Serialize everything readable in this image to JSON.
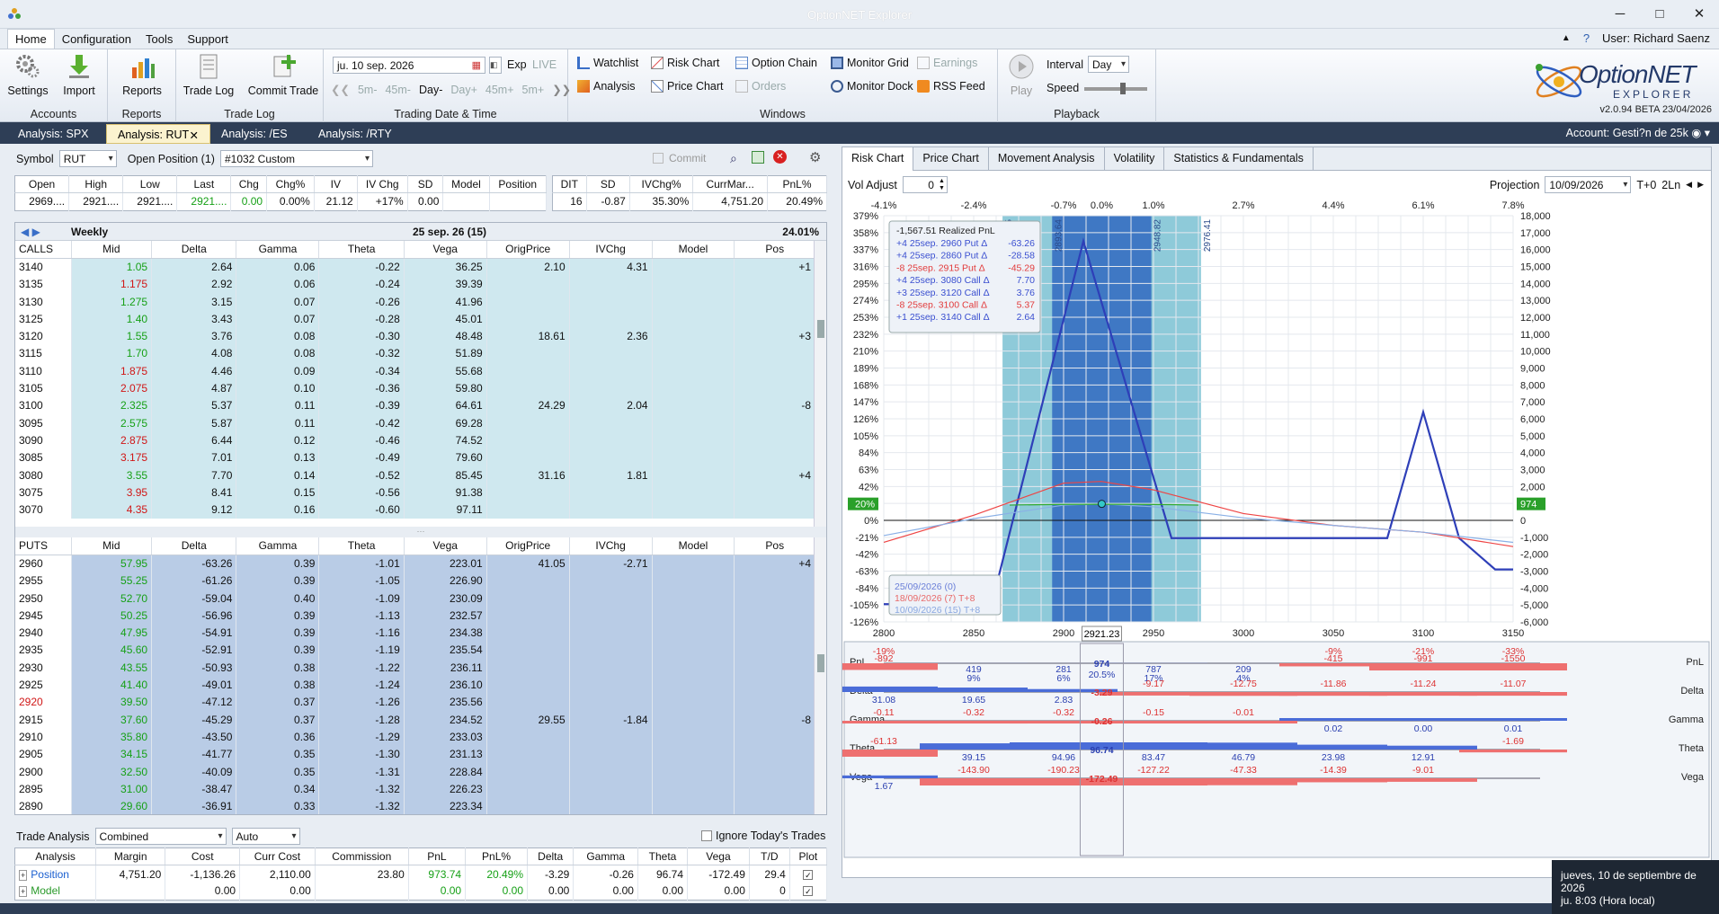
{
  "window": {
    "title": "OptionNET Explorer"
  },
  "menu": {
    "items": [
      "Home",
      "Configuration",
      "Tools",
      "Support"
    ],
    "user": "User: Richard Saenz"
  },
  "ribbon": {
    "settings": "Settings",
    "import": "Import",
    "accounts": "Accounts",
    "reports": "Reports",
    "reports_group": "Reports",
    "trade_log": "Trade Log",
    "commit_trade": "Commit Trade",
    "trade_log_group": "Trade Log",
    "date": "ju. 10 sep. 2026",
    "exp": "Exp",
    "live": "LIVE",
    "steps": [
      "5m-",
      "45m-",
      "Day-",
      "Day+",
      "45m+",
      "5m+"
    ],
    "trading_group": "Trading Date & Time",
    "watchlist": "Watchlist",
    "risk_chart": "Risk Chart",
    "option_chain": "Option Chain",
    "monitor_grid": "Monitor Grid",
    "earnings": "Earnings",
    "analysis": "Analysis",
    "price_chart": "Price Chart",
    "orders": "Orders",
    "monitor_dock": "Monitor Dock",
    "rss_feed": "RSS Feed",
    "windows_group": "Windows",
    "play": "Play",
    "interval_label": "Interval",
    "interval_value": "Day",
    "speed_label": "Speed",
    "playback_group": "Playback",
    "logo_main": "OptionNET",
    "logo_sub": "EXPLORER",
    "version": "v2.0.94 BETA 23/04/2026"
  },
  "tabs": [
    {
      "label": "Analysis: SPX"
    },
    {
      "label": "Analysis: RUT",
      "active": true
    },
    {
      "label": "Analysis: /ES"
    },
    {
      "label": "Analysis: /RTY"
    }
  ],
  "account": "Account: Gesti?n de 25k",
  "left": {
    "symbol_label": "Symbol",
    "symbol": "RUT",
    "open_position_label": "Open Position (1)",
    "position": "#1032 Custom",
    "commit": "Commit",
    "quote_headers": [
      "Open",
      "High",
      "Low",
      "Last",
      "Chg",
      "Chg%",
      "IV",
      "IV Chg",
      "SD",
      "Model",
      "Position"
    ],
    "quote_values": [
      "2969....",
      "2921....",
      "2921....",
      "2921....",
      "0.00",
      "0.00%",
      "21.12",
      "+17%",
      "0.00",
      "",
      ""
    ],
    "pos_headers": [
      "DIT",
      "SD",
      "IVChg%",
      "CurrMar...",
      "PnL%"
    ],
    "pos_values": [
      "16",
      "-0.87",
      "35.30%",
      "4,751.20",
      "20.49%"
    ],
    "weekly": "Weekly",
    "expiry": "25 sep. 26 (15)",
    "expiry_pct": "24.01%",
    "chain_headers": [
      "Mid",
      "Delta",
      "Gamma",
      "Theta",
      "Vega",
      "OrigPrice",
      "IVChg",
      "Model",
      "Pos"
    ],
    "calls_label": "CALLS",
    "puts_label": "PUTS",
    "calls": [
      [
        "3140",
        "1.05",
        "g",
        "2.64",
        "0.06",
        "-0.22",
        "36.25",
        "2.10",
        "4.31",
        "",
        "+1"
      ],
      [
        "3135",
        "1.175",
        "r",
        "2.92",
        "0.06",
        "-0.24",
        "39.39",
        "",
        "",
        "",
        ""
      ],
      [
        "3130",
        "1.275",
        "g",
        "3.15",
        "0.07",
        "-0.26",
        "41.96",
        "",
        "",
        "",
        ""
      ],
      [
        "3125",
        "1.40",
        "g",
        "3.43",
        "0.07",
        "-0.28",
        "45.01",
        "",
        "",
        "",
        ""
      ],
      [
        "3120",
        "1.55",
        "g",
        "3.76",
        "0.08",
        "-0.30",
        "48.48",
        "18.61",
        "2.36",
        "",
        "+3"
      ],
      [
        "3115",
        "1.70",
        "g",
        "4.08",
        "0.08",
        "-0.32",
        "51.89",
        "",
        "",
        "",
        ""
      ],
      [
        "3110",
        "1.875",
        "r",
        "4.46",
        "0.09",
        "-0.34",
        "55.68",
        "",
        "",
        "",
        ""
      ],
      [
        "3105",
        "2.075",
        "r",
        "4.87",
        "0.10",
        "-0.36",
        "59.80",
        "",
        "",
        "",
        ""
      ],
      [
        "3100",
        "2.325",
        "g",
        "5.37",
        "0.11",
        "-0.39",
        "64.61",
        "24.29",
        "2.04",
        "",
        "-8"
      ],
      [
        "3095",
        "2.575",
        "g",
        "5.87",
        "0.11",
        "-0.42",
        "69.28",
        "",
        "",
        "",
        ""
      ],
      [
        "3090",
        "2.875",
        "r",
        "6.44",
        "0.12",
        "-0.46",
        "74.52",
        "",
        "",
        "",
        ""
      ],
      [
        "3085",
        "3.175",
        "r",
        "7.01",
        "0.13",
        "-0.49",
        "79.60",
        "",
        "",
        "",
        ""
      ],
      [
        "3080",
        "3.55",
        "g",
        "7.70",
        "0.14",
        "-0.52",
        "85.45",
        "31.16",
        "1.81",
        "",
        "+4"
      ],
      [
        "3075",
        "3.95",
        "r",
        "8.41",
        "0.15",
        "-0.56",
        "91.38",
        "",
        "",
        "",
        ""
      ],
      [
        "3070",
        "4.35",
        "r",
        "9.12",
        "0.16",
        "-0.60",
        "97.11",
        "",
        "",
        "",
        ""
      ]
    ],
    "puts": [
      [
        "2960",
        "57.95",
        "g",
        "-63.26",
        "0.39",
        "-1.01",
        "223.01",
        "41.05",
        "-2.71",
        "",
        "+4"
      ],
      [
        "2955",
        "55.25",
        "g",
        "-61.26",
        "0.39",
        "-1.05",
        "226.90",
        "",
        "",
        "",
        ""
      ],
      [
        "2950",
        "52.70",
        "g",
        "-59.04",
        "0.40",
        "-1.09",
        "230.09",
        "",
        "",
        "",
        ""
      ],
      [
        "2945",
        "50.25",
        "g",
        "-56.96",
        "0.39",
        "-1.13",
        "232.57",
        "",
        "",
        "",
        ""
      ],
      [
        "2940",
        "47.95",
        "g",
        "-54.91",
        "0.39",
        "-1.16",
        "234.38",
        "",
        "",
        "",
        ""
      ],
      [
        "2935",
        "45.60",
        "g",
        "-52.91",
        "0.39",
        "-1.19",
        "235.54",
        "",
        "",
        "",
        ""
      ],
      [
        "2930",
        "43.55",
        "g",
        "-50.93",
        "0.38",
        "-1.22",
        "236.11",
        "",
        "",
        "",
        ""
      ],
      [
        "2925",
        "41.40",
        "g",
        "-49.01",
        "0.38",
        "-1.24",
        "236.10",
        "",
        "",
        "",
        ""
      ],
      [
        "2920",
        "39.50",
        "g",
        "-47.12",
        "0.37",
        "-1.26",
        "235.56",
        "",
        "",
        "",
        ""
      ],
      [
        "2915",
        "37.60",
        "g",
        "-45.29",
        "0.37",
        "-1.28",
        "234.52",
        "29.55",
        "-1.84",
        "",
        "-8"
      ],
      [
        "2910",
        "35.80",
        "g",
        "-43.50",
        "0.36",
        "-1.29",
        "233.03",
        "",
        "",
        "",
        ""
      ],
      [
        "2905",
        "34.15",
        "g",
        "-41.77",
        "0.35",
        "-1.30",
        "231.13",
        "",
        "",
        "",
        ""
      ],
      [
        "2900",
        "32.50",
        "g",
        "-40.09",
        "0.35",
        "-1.31",
        "228.84",
        "",
        "",
        "",
        ""
      ],
      [
        "2895",
        "31.00",
        "g",
        "-38.47",
        "0.34",
        "-1.32",
        "226.23",
        "",
        "",
        "",
        ""
      ],
      [
        "2890",
        "29.60",
        "g",
        "-36.91",
        "0.33",
        "-1.32",
        "223.34",
        "",
        "",
        "",
        ""
      ]
    ],
    "trade_analysis_label": "Trade Analysis",
    "combined": "Combined",
    "auto": "Auto",
    "ignore_today": "Ignore Today's Trades",
    "ta_headers": [
      "Analysis",
      "Margin",
      "Cost",
      "Curr Cost",
      "Commission",
      "PnL",
      "PnL%",
      "Delta",
      "Gamma",
      "Theta",
      "Vega",
      "T/D",
      "Plot"
    ],
    "ta_position": [
      "Position",
      "4,751.20",
      "-1,136.26",
      "2,110.00",
      "23.80",
      "973.74",
      "20.49%",
      "-3.29",
      "-0.26",
      "96.74",
      "-172.49",
      "29.4",
      ""
    ],
    "ta_model": [
      "Model",
      "",
      "0.00",
      "0.00",
      "",
      "0.00",
      "0.00",
      "0.00",
      "0.00",
      "0.00",
      "0.00",
      "0",
      ""
    ]
  },
  "right": {
    "tabs": [
      "Risk Chart",
      "Price Chart",
      "Movement Analysis",
      "Volatility",
      "Statistics & Fundamentals"
    ],
    "vol_adjust_label": "Vol Adjust",
    "vol_adjust": "0",
    "projection_label": "Projection",
    "projection_date": "10/09/2026",
    "tplus": "T+0",
    "lines": "2Ln",
    "legend_title": "-1,567.51 Realized PnL",
    "legend": [
      {
        "text": "+4 25sep. 2960 Put Δ",
        "val": "-63.26",
        "color": "#3a4fd0"
      },
      {
        "text": "+4 25sep. 2860 Put Δ",
        "val": "-28.58",
        "color": "#3a4fd0"
      },
      {
        "text": "-8 25sep. 2915 Put Δ",
        "val": "-45.29",
        "color": "#e23b3b"
      },
      {
        "text": "+4 25sep. 3080 Call Δ",
        "val": "7.70",
        "color": "#3a4fd0"
      },
      {
        "text": "+3 25sep. 3120 Call Δ",
        "val": "3.76",
        "color": "#3a4fd0"
      },
      {
        "text": "-8 25sep. 3100 Call Δ",
        "val": "5.37",
        "color": "#e23b3b"
      },
      {
        "text": "+1 25sep. 3140 Call Δ",
        "val": "2.64",
        "color": "#3a4fd0"
      }
    ],
    "date_legend": [
      {
        "text": "25/09/2026 (0)",
        "color": "#6a7fd8"
      },
      {
        "text": "18/09/2026 (7) T+8",
        "color": "#e86a6a"
      },
      {
        "text": "10/09/2026 (15) T+8",
        "color": "#8aa8e0"
      }
    ],
    "pct_labels": [
      "-4.1%",
      "-2.4%",
      "-0.7%",
      "0.0%",
      "1.0%",
      "2.7%",
      "4.4%",
      "6.1%",
      "7.8%"
    ],
    "left_axis": [
      "379%",
      "358%",
      "337%",
      "316%",
      "295%",
      "274%",
      "253%",
      "232%",
      "210%",
      "189%",
      "168%",
      "147%",
      "126%",
      "105%",
      "84%",
      "63%",
      "42%",
      "20%",
      "0%",
      "-21%",
      "-42%",
      "-63%",
      "-84%",
      "-105%",
      "-126%"
    ],
    "right_axis": [
      "18,000",
      "17,000",
      "16,000",
      "15,000",
      "14,000",
      "13,000",
      "12,000",
      "11,000",
      "10,000",
      "9,000",
      "8,000",
      "7,000",
      "6,000",
      "5,000",
      "4,000",
      "3,000",
      "2,000",
      "1,000",
      "0",
      "-1,000",
      "-2,000",
      "-3,000",
      "-4,000",
      "-5,000",
      "-6,000"
    ],
    "x_labels": [
      "2800",
      "2850",
      "2900",
      "2950",
      "3000",
      "3050",
      "3100",
      "3150"
    ],
    "spot_label": "2921.23",
    "band_labels": [
      "2866.05",
      "2893.64",
      "2948.82",
      "2976.41"
    ],
    "current_left": "20%",
    "current_right": "974",
    "greek_rows": [
      {
        "name": "PnL",
        "cur": "974",
        "cur2": "20.5%",
        "vals": [
          "-19%",
          "-892",
          "419",
          "9%",
          "281",
          "6%",
          "787",
          "17%",
          "209",
          "4%",
          "-9%",
          "-415",
          "-21%",
          "-991",
          "-33%",
          "-1550"
        ]
      },
      {
        "name": "Delta",
        "cur": "-3.29",
        "vals": [
          "31.08",
          "19.65",
          "2.83",
          "-9.17",
          "-12.75",
          "-11.86",
          "-11.24",
          "-11.07"
        ]
      },
      {
        "name": "Gamma",
        "cur": "-0.26",
        "vals": [
          "-0.11",
          "-0.32",
          "-0.32",
          "-0.15",
          "-0.01",
          "0.02",
          "0.00",
          "0.01"
        ]
      },
      {
        "name": "Theta",
        "cur": "96.74",
        "vals": [
          "-61.13",
          "39.15",
          "94.96",
          "83.47",
          "46.79",
          "23.98",
          "12.91",
          "-1.69"
        ]
      },
      {
        "name": "Vega",
        "cur": "-172.49",
        "vals": [
          "1.67",
          "-143.90",
          "-190.23",
          "-127.22",
          "-47.33",
          "-14.39",
          "-9.01",
          ""
        ]
      }
    ]
  },
  "chart_data": {
    "type": "line",
    "x_range": [
      2800,
      3150
    ],
    "pnl_range": [
      -6000,
      18000
    ],
    "series": [
      {
        "name": "25/09/2026 (0)",
        "x": [
          2800,
          2860,
          2911,
          2960,
          2980,
          3080,
          3100,
          3120,
          3140,
          3150
        ],
        "y": [
          -4950,
          -4950,
          16500,
          -1050,
          -1050,
          -1050,
          6400,
          -1050,
          -2900,
          -2900
        ]
      },
      {
        "name": "18/09/2026 (7) T+8",
        "x": [
          2800,
          2850,
          2900,
          2921,
          2950,
          3000,
          3050,
          3100,
          3150
        ],
        "y": [
          -1300,
          300,
          2200,
          2300,
          1800,
          400,
          -300,
          -700,
          -1550
        ]
      },
      {
        "name": "10/09/2026 (15) T+8",
        "x": [
          2800,
          2850,
          2900,
          2921,
          2950,
          3000,
          3050,
          3100,
          3150
        ],
        "y": [
          -900,
          100,
          900,
          974,
          800,
          150,
          -300,
          -700,
          -1300
        ]
      }
    ],
    "current": {
      "x": 2921.23,
      "y": 974
    }
  },
  "clock": {
    "date": "jueves, 10 de septiembre de 2026",
    "time": "ju. 8:03 (Hora local)"
  }
}
